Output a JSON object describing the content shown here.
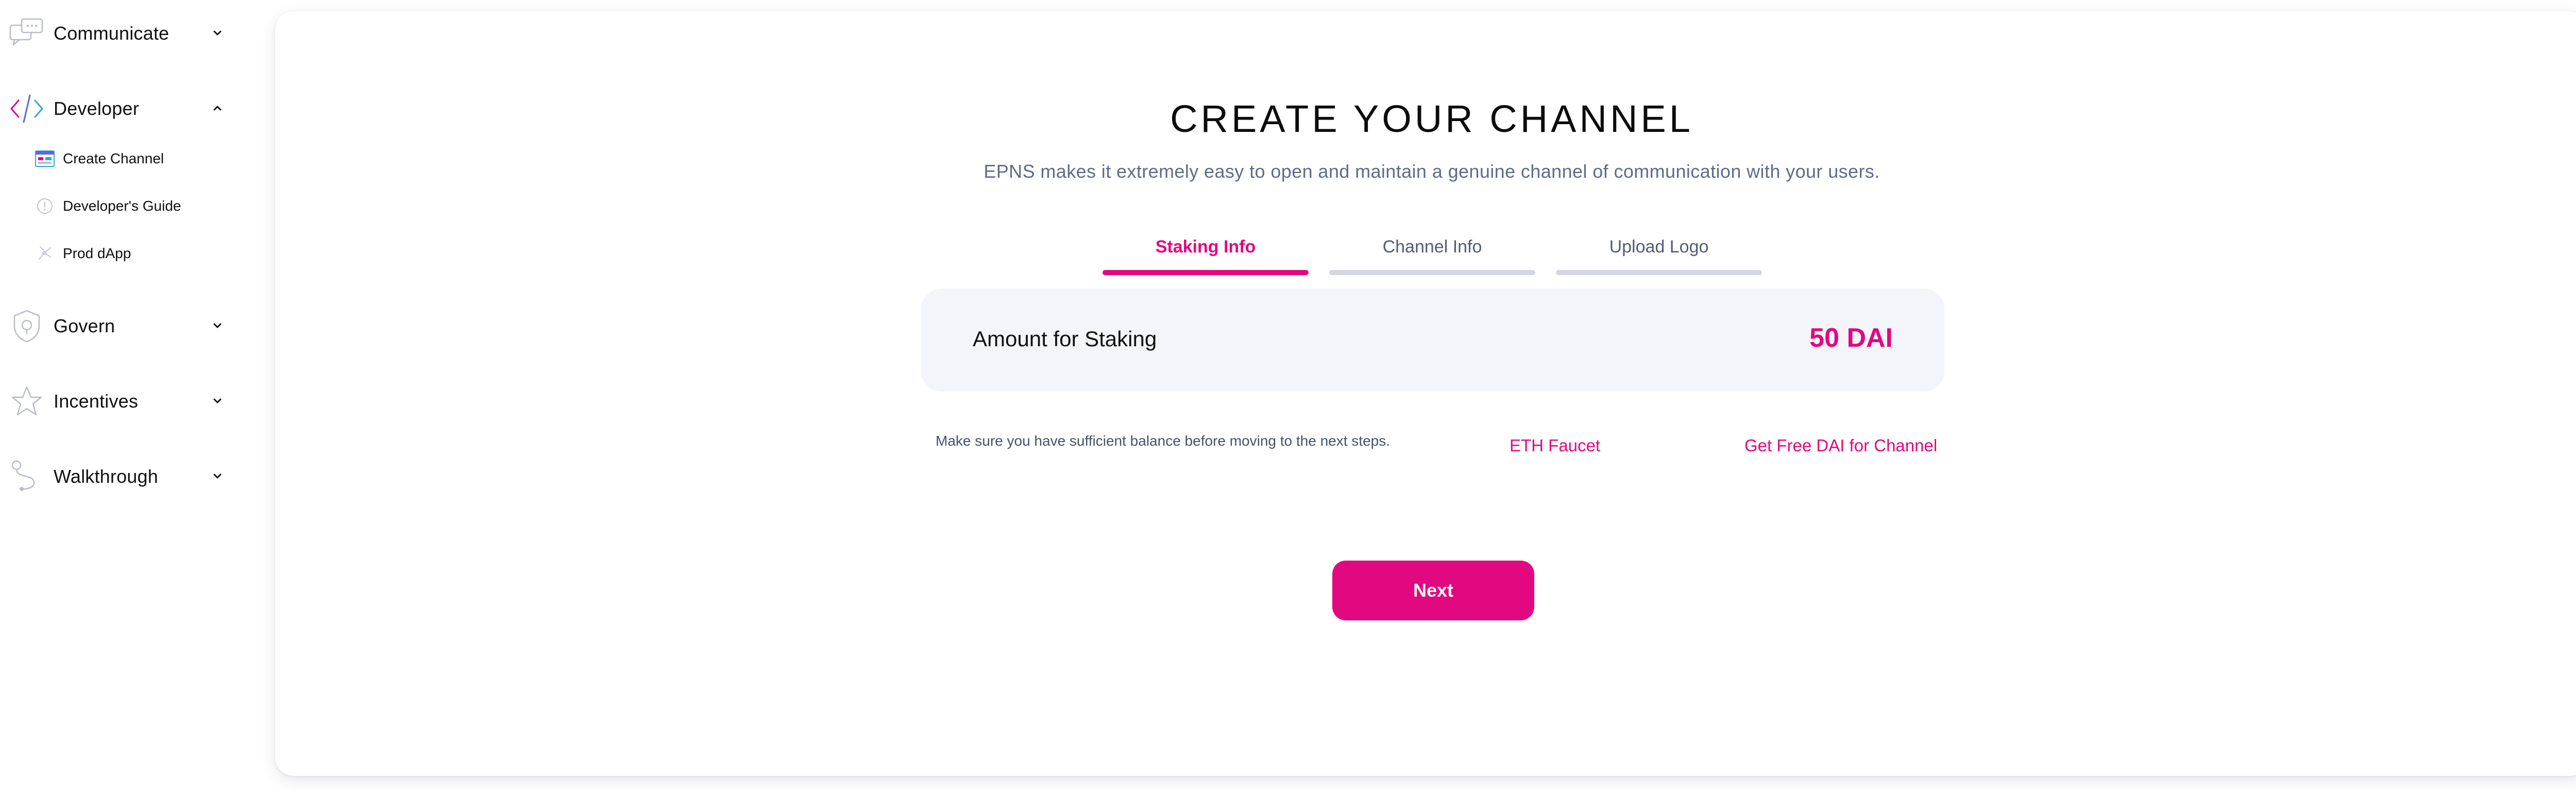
{
  "sidebar": {
    "sections": {
      "communicate": {
        "label": "Communicate",
        "expanded": false,
        "icon": "chat-bubbles-icon"
      },
      "developer": {
        "label": "Developer",
        "expanded": true,
        "icon": "code-brackets-icon",
        "items": [
          {
            "label": "Create Channel",
            "icon": "create-channel-icon",
            "active": true
          },
          {
            "label": "Developer's Guide",
            "icon": "guide-icon"
          },
          {
            "label": "Prod dApp",
            "icon": "prod-dapp-icon"
          }
        ]
      },
      "govern": {
        "label": "Govern",
        "expanded": false,
        "icon": "shield-icon"
      },
      "incentives": {
        "label": "Incentives",
        "expanded": false,
        "icon": "star-icon"
      },
      "walkthrough": {
        "label": "Walkthrough",
        "expanded": false,
        "icon": "path-icon"
      }
    }
  },
  "main": {
    "title": "CREATE YOUR CHANNEL",
    "subtitle": "EPNS makes it extremely easy to open and maintain a genuine channel of communication with your users.",
    "tabs": [
      {
        "label": "Staking Info",
        "active": true
      },
      {
        "label": "Channel Info",
        "active": false
      },
      {
        "label": "Upload Logo",
        "active": false
      }
    ],
    "staking": {
      "label": "Amount for Staking",
      "amount": "50 DAI"
    },
    "note": "Make sure you have sufficient balance before moving to the next steps.",
    "links": {
      "faucet": "ETH Faucet",
      "free_dai": "Get Free DAI for Channel"
    },
    "next_label": "Next"
  },
  "colors": {
    "accent": "#e20880",
    "tab_inactive": "#d4d7e0",
    "stake_bg": "#f4f5fa",
    "subtitle": "#5f6b8a"
  }
}
